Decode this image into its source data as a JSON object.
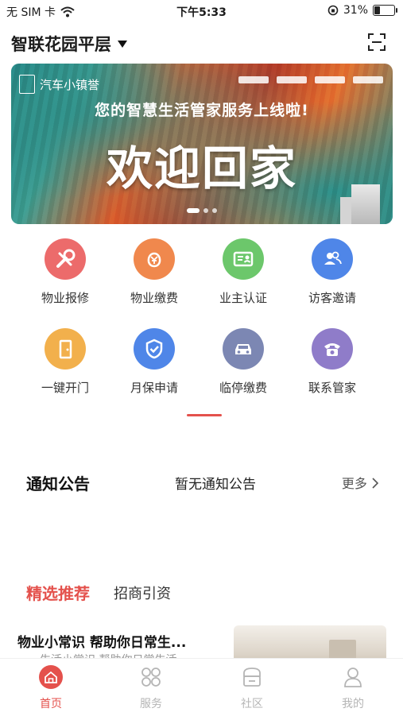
{
  "status_bar": {
    "carrier": "无 SIM 卡",
    "time": "下午5:33",
    "battery_percent": "31%",
    "battery_level": 0.31
  },
  "header": {
    "community_name": "智联花园平层"
  },
  "banner": {
    "logo_text": "汽车小镇誉",
    "slogan": "您的智慧生活管家服务上线啦!",
    "headline": "欢迎回家",
    "slide_count": 3,
    "active_slide": 1
  },
  "services": [
    {
      "label": "物业报修",
      "icon": "wrench-icon",
      "color": "#ec6b6b"
    },
    {
      "label": "物业缴费",
      "icon": "yen-bag-icon",
      "color": "#f0884d"
    },
    {
      "label": "业主认证",
      "icon": "id-card-icon",
      "color": "#6cc76b"
    },
    {
      "label": "访客邀请",
      "icon": "visitors-icon",
      "color": "#4f86e8"
    },
    {
      "label": "一键开门",
      "icon": "door-icon",
      "color": "#f2b04c"
    },
    {
      "label": "月保申请",
      "icon": "shield-check-icon",
      "color": "#4f86e8"
    },
    {
      "label": "临停缴费",
      "icon": "car-icon",
      "color": "#7c87b3"
    },
    {
      "label": "联系管家",
      "icon": "phone-icon",
      "color": "#8f7cc9"
    }
  ],
  "notice": {
    "title": "通知公告",
    "message": "暂无通知公告",
    "more": "更多"
  },
  "feature_tabs": {
    "active": "精选推荐",
    "other": "招商引资"
  },
  "article": {
    "title": "物业小常识 帮助你日常生...",
    "subtitle": "——生活小常识  帮助你日常生活"
  },
  "tab_bar": [
    {
      "label": "首页",
      "icon": "home-icon",
      "active": true
    },
    {
      "label": "服务",
      "icon": "service-grid-icon",
      "active": false
    },
    {
      "label": "社区",
      "icon": "community-icon",
      "active": false
    },
    {
      "label": "我的",
      "icon": "profile-icon",
      "active": false
    }
  ],
  "colors": {
    "accent": "#e4514c",
    "inactive": "#b5b5b5"
  }
}
